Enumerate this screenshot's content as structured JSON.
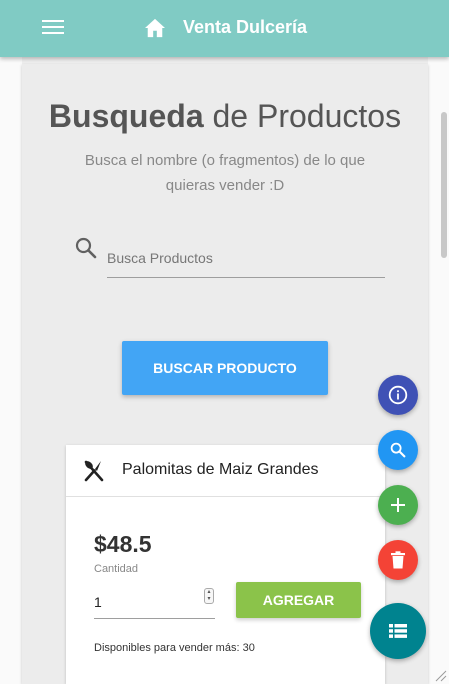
{
  "app": {
    "title": "Venta Dulcería"
  },
  "header": {
    "menu_icon": "menu-icon",
    "home_icon": "home-icon"
  },
  "main": {
    "heading_bold": "Busqueda",
    "heading_rest": " de Productos",
    "subtitle": "Busca el nombre (o fragmentos) de lo que quieras vender :D",
    "search": {
      "placeholder": "Busca Productos",
      "value": ""
    },
    "search_button": "BUSCAR PRODUCTO"
  },
  "product_card": {
    "name": "Palomitas de Maiz Grandes",
    "price": "$48.5",
    "quantity_label": "Cantidad",
    "quantity_value": "1",
    "add_button": "AGREGAR",
    "available": "Disponibles para vender más: 30"
  },
  "fabs": [
    {
      "icon": "info-icon",
      "color": "#3f51b5"
    },
    {
      "icon": "search-icon",
      "color": "#2196f3"
    },
    {
      "icon": "plus-icon",
      "color": "#4caf50"
    },
    {
      "icon": "trash-icon",
      "color": "#f44336"
    },
    {
      "icon": "list-icon",
      "color": "#00838f"
    }
  ],
  "colors": {
    "appbar": "#80cbc4",
    "primary_button": "#42a5f5",
    "add_button": "#8bc34a"
  }
}
